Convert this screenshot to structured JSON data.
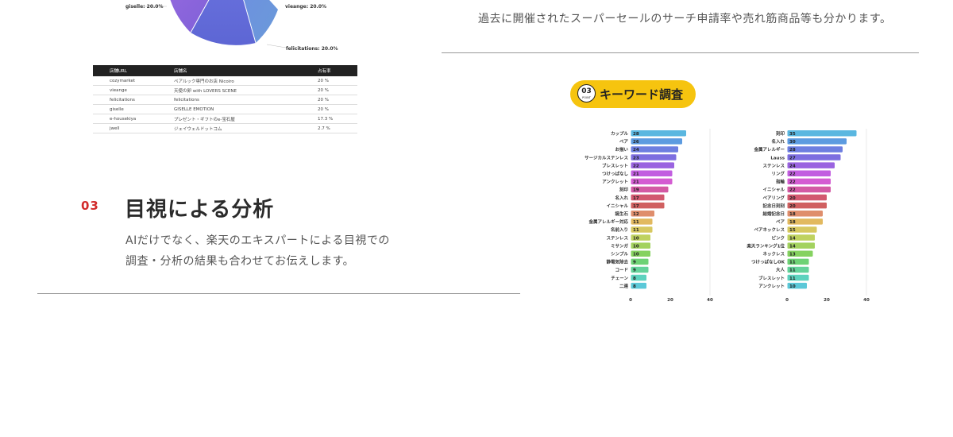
{
  "pie": {
    "labels": [
      {
        "text": "giselle: 20.0%"
      },
      {
        "text": "vieange: 20.0%"
      },
      {
        "text": "felicitations: 20.0%"
      }
    ]
  },
  "share_table": {
    "headers": [
      "店舗URL",
      "店舗名",
      "占有率"
    ],
    "rows": [
      [
        "cozymarket",
        "ペアルック専門のお店 Nicoiro",
        "20 %"
      ],
      [
        "vieange",
        "天使の卵 with LOVERS SCENE",
        "20 %"
      ],
      [
        "felicitations",
        "felicitations",
        "20 %"
      ],
      [
        "giselle",
        "GISELLE EMOTION",
        "20 %"
      ],
      [
        "e-housekiya",
        "プレゼント・ギフトのe-宝石屋",
        "17.3 %"
      ],
      [
        "jwell",
        "ジェイウェルドットコム",
        "2.7 %"
      ]
    ]
  },
  "section": {
    "number": "03",
    "title": "目視による分析",
    "lines": [
      "AIだけでなく、楽天のエキスパートによる目視での",
      "調査・分析の結果も合わせてお伝えします。"
    ]
  },
  "right": {
    "description": "過去に開催されたスーパーセールのサーチ申請率や売れ筋商品等も分かります。"
  },
  "badge": {
    "number": "03",
    "point_text": "POINT",
    "title": "キーワード調査"
  },
  "chart_data": [
    {
      "type": "bar",
      "orientation": "horizontal",
      "categories": [
        "カップル",
        "ペア",
        "お揃い",
        "サージカルステンレス",
        "ブレスレット",
        "つけっぱなし",
        "アンクレット",
        "刻印",
        "名入れ",
        "イニシャル",
        "誕生石",
        "金属アレルギー対応",
        "名前入り",
        "ステンレス",
        "ミサンガ",
        "シンプル",
        "静電気除去",
        "コード",
        "チェーン",
        "二連"
      ],
      "values": [
        28,
        26,
        24,
        23,
        22,
        21,
        21,
        19,
        17,
        17,
        12,
        11,
        11,
        10,
        10,
        10,
        9,
        9,
        8,
        8
      ],
      "xticks": [
        "0",
        "20",
        "40"
      ],
      "xlim": [
        0,
        40
      ]
    },
    {
      "type": "bar",
      "orientation": "horizontal",
      "categories": [
        "刻印",
        "名入れ",
        "金属アレルギー",
        "Lauss",
        "ステンレス",
        "リング",
        "指輪",
        "イニシャル",
        "ペアリング",
        "記念日刻刻",
        "結婚記念日",
        "ペア",
        "ペアネックレス",
        "ピンク",
        "楽天ランキング1位",
        "ネックレス",
        "つけっぱなしOK",
        "大人",
        "ブレスレット",
        "アンクレット"
      ],
      "values": [
        35,
        30,
        28,
        27,
        24,
        22,
        22,
        22,
        20,
        20,
        18,
        18,
        15,
        14,
        14,
        13,
        11,
        11,
        11,
        10
      ],
      "xticks": [
        "0",
        "20",
        "40"
      ],
      "xlim": [
        0,
        40
      ]
    }
  ],
  "colors": {
    "section_number": "#d22b2b",
    "badge": "#f6c40f",
    "bar_palette": [
      "#5ab7e0",
      "#5c9be0",
      "#6d7ee0",
      "#7d6ee0",
      "#9a63e0",
      "#c25ee0",
      "#d45cd2",
      "#d35aa4",
      "#d2586f",
      "#d06060",
      "#df8e6c",
      "#e2b95f",
      "#d7c860",
      "#bfd25f",
      "#a3d25f",
      "#85d260",
      "#6ed275",
      "#64d29a",
      "#5cd2be",
      "#5bc8d8"
    ]
  }
}
